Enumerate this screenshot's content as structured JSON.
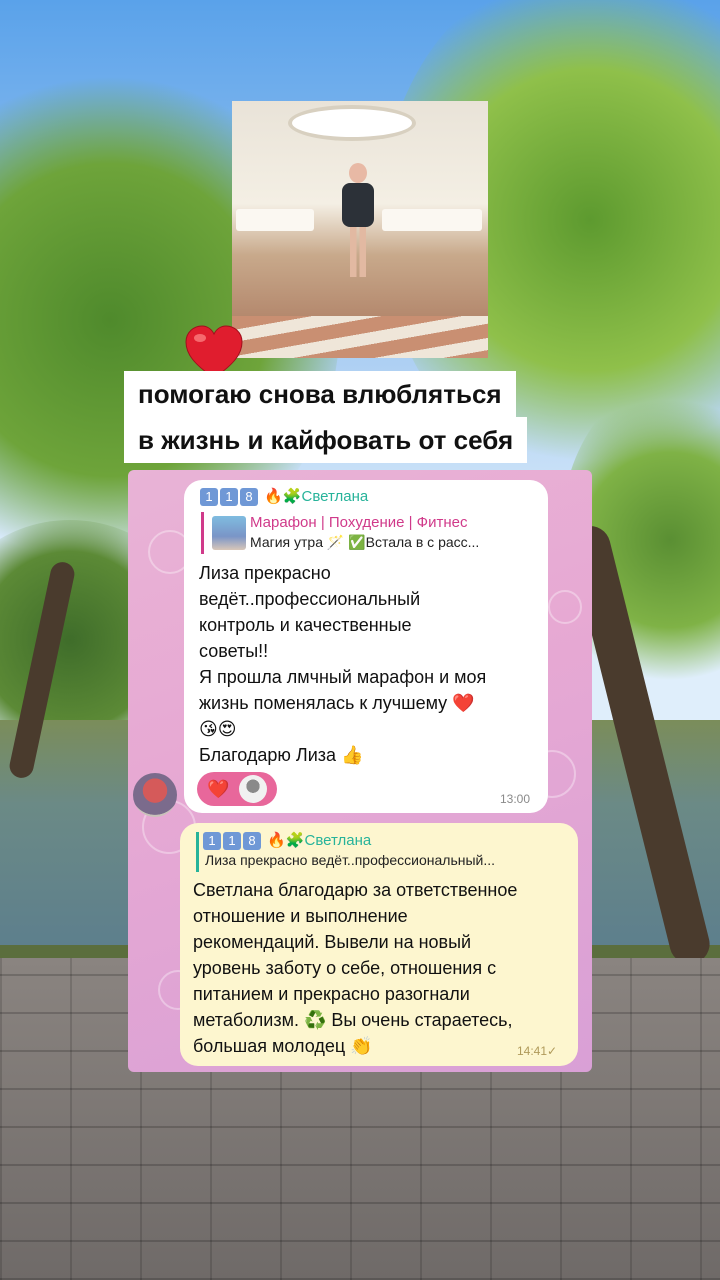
{
  "headline": {
    "line1": "помогаю снова влюбляться",
    "line2": "в жизнь и кайфовать от себя"
  },
  "heart_icon": "❤️",
  "chat": {
    "message1": {
      "sender_badges": [
        "1",
        "1",
        "8"
      ],
      "sender_emoji": "🔥🧩",
      "sender_name": "Светлана",
      "quote_title": "Марафон | Похудение | Фитнес",
      "quote_text": "Магия утра 🪄 ✅Встала в с расс...",
      "text": "Лиза прекрасно\nведёт..профессиональный\nконтроль и качественные\nсоветы!!\nЯ прошла лмчный марафон и моя\nжизнь поменялась к лучшему ❤️\n😘😍\nБлагодарю Лиза 👍",
      "time": "13:00",
      "reaction": "❤️"
    },
    "message2": {
      "sender_badges": [
        "1",
        "1",
        "8"
      ],
      "sender_emoji": "🔥🧩",
      "sender_name": "Светлана",
      "quote_text": "Лиза прекрасно ведёт..профессиональный...",
      "text": "Светлана благодарю за ответственное\nотношение и выполнение\nрекомендаций. Вывели на новый\nуровень заботу о себе, отношения с\nпитанием и прекрасно разогнали\nметаболизм. ♻️ Вы очень стараетесь,\nбольшая молодец 👏",
      "time": "14:41",
      "status_icon": "✓"
    }
  },
  "colors": {
    "panel_pink": "#e7a9d3",
    "sender_green": "#27b39a",
    "quote_magenta": "#d03a8a",
    "reply_bubble": "#fdf6cf",
    "reaction_pill": "#e8679b"
  },
  "icons": {
    "heart": "heart-icon",
    "badge": "number-badge-icon",
    "read_check": "check-icon"
  }
}
